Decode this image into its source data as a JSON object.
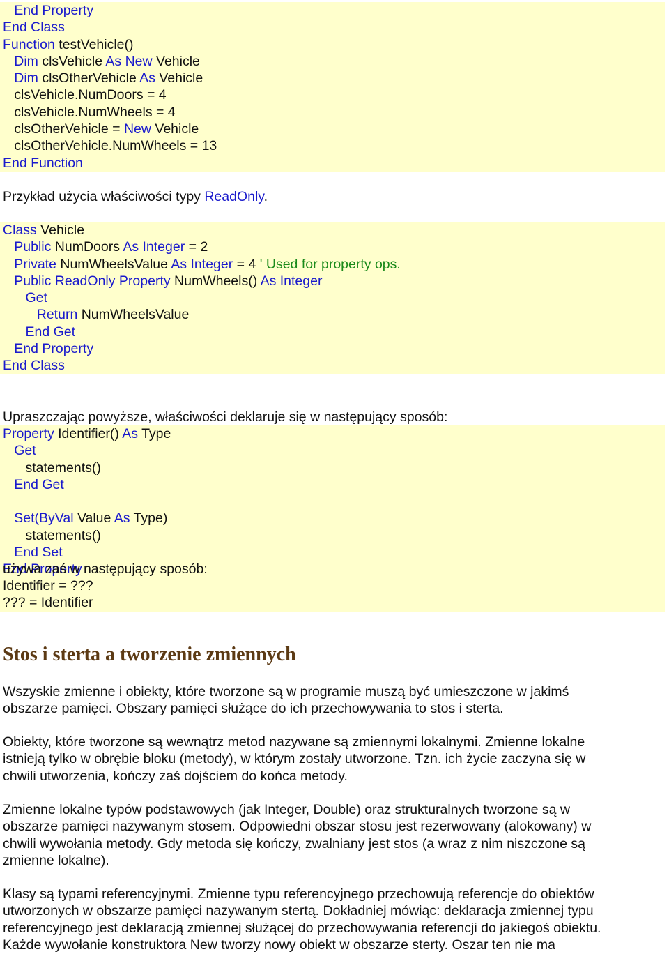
{
  "blocks": [
    {
      "type": "code",
      "lines": [
        [
          [
            "kw",
            "   End Property"
          ]
        ],
        [
          [
            "kw",
            "End Class"
          ]
        ],
        [
          [
            "kw",
            "Function"
          ],
          [
            "tx",
            " testVehicle()"
          ]
        ],
        [
          [
            "kw",
            "   Dim"
          ],
          [
            "tx",
            " clsVehicle "
          ],
          [
            "kw",
            "As New"
          ],
          [
            "tx",
            " Vehicle"
          ]
        ],
        [
          [
            "kw",
            "   Dim"
          ],
          [
            "tx",
            " clsOtherVehicle "
          ],
          [
            "kw",
            "As"
          ],
          [
            "tx",
            " Vehicle"
          ]
        ],
        [
          [
            "tx",
            "   clsVehicle.NumDoors = 4"
          ]
        ],
        [
          [
            "tx",
            "   clsVehicle.NumWheels = 4"
          ]
        ],
        [
          [
            "tx",
            "   clsOtherVehicle = "
          ],
          [
            "kw",
            "New"
          ],
          [
            "tx",
            " Vehicle"
          ]
        ],
        [
          [
            "tx",
            "   clsOtherVehicle.NumWheels = 13"
          ]
        ],
        [
          [
            "kw",
            "End Function"
          ]
        ]
      ]
    },
    {
      "type": "text",
      "lines": [
        [
          [
            "tx",
            "Przykład użycia właściwości typy "
          ],
          [
            "kw",
            "ReadOnly"
          ],
          [
            "tx",
            "."
          ]
        ]
      ]
    },
    {
      "type": "code",
      "lines": [
        [
          [
            "kw",
            "Class"
          ],
          [
            "tx",
            " Vehicle"
          ]
        ],
        [
          [
            "kw",
            "   Public"
          ],
          [
            "tx",
            " NumDoors "
          ],
          [
            "kw",
            "As Integer"
          ],
          [
            "tx",
            " = 2"
          ]
        ],
        [
          [
            "kw",
            "   Private"
          ],
          [
            "tx",
            " NumWheelsValue "
          ],
          [
            "kw",
            "As Integer"
          ],
          [
            "tx",
            " = 4 "
          ],
          [
            "cm",
            "' Used for property ops."
          ]
        ],
        [
          [
            "kw",
            "   Public ReadOnly Property"
          ],
          [
            "tx",
            " NumWheels() "
          ],
          [
            "kw",
            "As Integer"
          ]
        ],
        [
          [
            "kw",
            "      Get"
          ]
        ],
        [
          [
            "kw",
            "         Return"
          ],
          [
            "tx",
            " NumWheelsValue"
          ]
        ],
        [
          [
            "kw",
            "      End Get"
          ]
        ],
        [
          [
            "kw",
            "   End Property"
          ]
        ],
        [
          [
            "kw",
            "End Class"
          ]
        ]
      ]
    },
    {
      "type": "text",
      "lines": [
        [
          [
            "tx",
            "Upraszczając powyższe, właściwości deklaruje się w następujący sposób:"
          ]
        ]
      ]
    },
    {
      "type": "code",
      "lines": [
        [
          [
            "kw",
            "Property"
          ],
          [
            "tx",
            " Identifier() "
          ],
          [
            "kw",
            "As"
          ],
          [
            "tx",
            " Type"
          ]
        ],
        [
          [
            "kw",
            "   Get"
          ]
        ],
        [
          [
            "tx",
            "      statements()"
          ]
        ],
        [
          [
            "kw",
            "   End Get"
          ]
        ],
        [
          [
            "tx",
            ""
          ]
        ],
        [
          [
            "kw",
            "   Set("
          ],
          [
            "kw",
            "ByVal"
          ],
          [
            "tx",
            " Value "
          ],
          [
            "kw",
            "As"
          ],
          [
            "tx",
            " Type)"
          ]
        ],
        [
          [
            "tx",
            "      statements()"
          ]
        ],
        [
          [
            "kw",
            "   End Set"
          ]
        ],
        [
          [
            "kw",
            "End Property"
          ]
        ]
      ]
    },
    {
      "type": "text",
      "lines": [
        [
          [
            "tx",
            "używa zaś w następujący sposób:"
          ]
        ]
      ]
    },
    {
      "type": "code",
      "lines": [
        [
          [
            "tx",
            "Identifier = ???"
          ]
        ],
        [
          [
            "tx",
            "??? = Identifier"
          ]
        ]
      ]
    }
  ],
  "heading": "Stos i sterta a tworzenie zmiennych",
  "paragraphs": [
    [
      "Wszyskie zmienne i obiekty, które tworzone są w programie muszą być umieszczone w jakimś",
      "obszarze pamięci. Obszary pamięci służące do ich przechowywania to stos i sterta."
    ],
    [
      "Obiekty, które tworzone są wewnątrz metod nazywane są zmiennymi lokalnymi. Zmienne lokalne",
      "istnieją tylko w obrębie bloku (metody), w którym zostały utworzone. Tzn. ich życie zaczyna się w",
      "chwili utworzenia, kończy zaś dojściem do końca metody."
    ],
    [
      "Zmienne lokalne typów podstawowych (jak Integer, Double) oraz strukturalnych tworzone są w",
      "obszarze pamięci nazywanym stosem. Odpowiedni obszar stosu jest rezerwowany (alokowany) w",
      "chwili wywołania metody. Gdy metoda się kończy, zwalniany jest stos (a wraz z nim niszczone są",
      "zmienne lokalne)."
    ],
    [
      "Klasy są typami referencyjnymi. Zmienne typu referencyjnego przechowują referencje do obiektów",
      "utworzonych w obszarze pamięci nazywanym stertą. Dokładniej mówiąc: deklaracja zmiennej typu",
      "referencyjnego jest deklaracją zmiennej służącej do przechowywania referencji do jakiegoś obiektu.",
      "Każde wywołanie konstruktora New tworzy nowy obiekt w obszarze sterty. Oszar ten nie ma"
    ]
  ],
  "colors": {
    "keyword": "#1a1acc",
    "comment": "#1a8a1a",
    "code_bg": "#ffffcc",
    "heading": "#5c3a14"
  }
}
